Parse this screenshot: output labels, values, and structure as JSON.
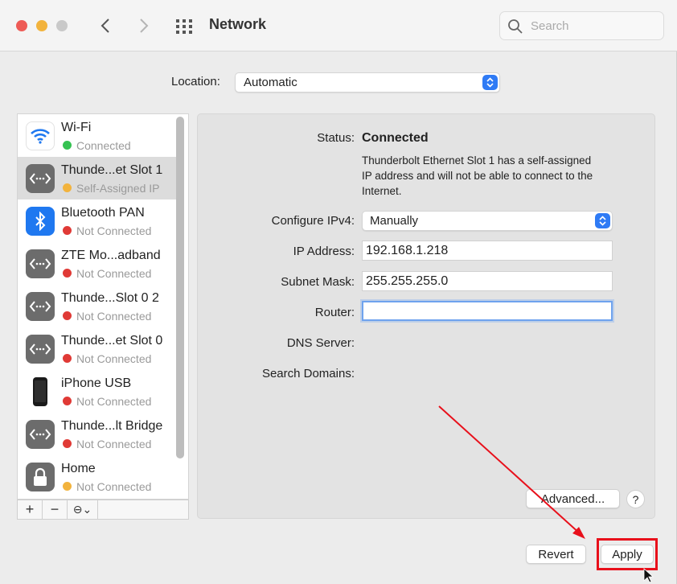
{
  "titlebar": {
    "title": "Network",
    "search_placeholder": "Search"
  },
  "location": {
    "label": "Location:",
    "value": "Automatic"
  },
  "services": [
    {
      "name": "Wi-Fi",
      "status": "Connected",
      "status_color": "#35c252",
      "icon": "wifi-icon"
    },
    {
      "name": "Thunde...et Slot 1",
      "status": "Self-Assigned IP",
      "status_color": "#f2b33d",
      "icon": "ethernet-icon"
    },
    {
      "name": "Bluetooth PAN",
      "status": "Not Connected",
      "status_color": "#e03a36",
      "icon": "bluetooth-icon"
    },
    {
      "name": "ZTE Mo...adband",
      "status": "Not Connected",
      "status_color": "#e03a36",
      "icon": "ethernet-icon"
    },
    {
      "name": "Thunde...Slot 0 2",
      "status": "Not Connected",
      "status_color": "#e03a36",
      "icon": "ethernet-icon"
    },
    {
      "name": "Thunde...et Slot 0",
      "status": "Not Connected",
      "status_color": "#e03a36",
      "icon": "ethernet-icon"
    },
    {
      "name": "iPhone USB",
      "status": "Not Connected",
      "status_color": "#e03a36",
      "icon": "iphone-icon"
    },
    {
      "name": "Thunde...lt Bridge",
      "status": "Not Connected",
      "status_color": "#e03a36",
      "icon": "ethernet-icon"
    },
    {
      "name": "Home",
      "status": "Not Connected",
      "status_color": "#f2b33d",
      "icon": "lock-icon"
    }
  ],
  "list_toolbar": {
    "add": "+",
    "remove": "−",
    "action": "⊖⌄"
  },
  "detail": {
    "status_label": "Status:",
    "status_value": "Connected",
    "status_desc": "Thunderbolt Ethernet Slot 1 has a self-assigned IP address and will not be able to connect to the Internet.",
    "configure_label": "Configure IPv4:",
    "configure_value": "Manually",
    "ip_label": "IP Address:",
    "ip_value": "192.168.1.218",
    "subnet_label": "Subnet Mask:",
    "subnet_value": "255.255.255.0",
    "router_label": "Router:",
    "router_value": "",
    "dns_label": "DNS Server:",
    "search_domains_label": "Search Domains:",
    "advanced_label": "Advanced...",
    "help_label": "?"
  },
  "footer": {
    "revert_label": "Revert",
    "apply_label": "Apply"
  },
  "colors": {
    "accent": "#2f7bf5",
    "annotation": "#e8101b"
  }
}
